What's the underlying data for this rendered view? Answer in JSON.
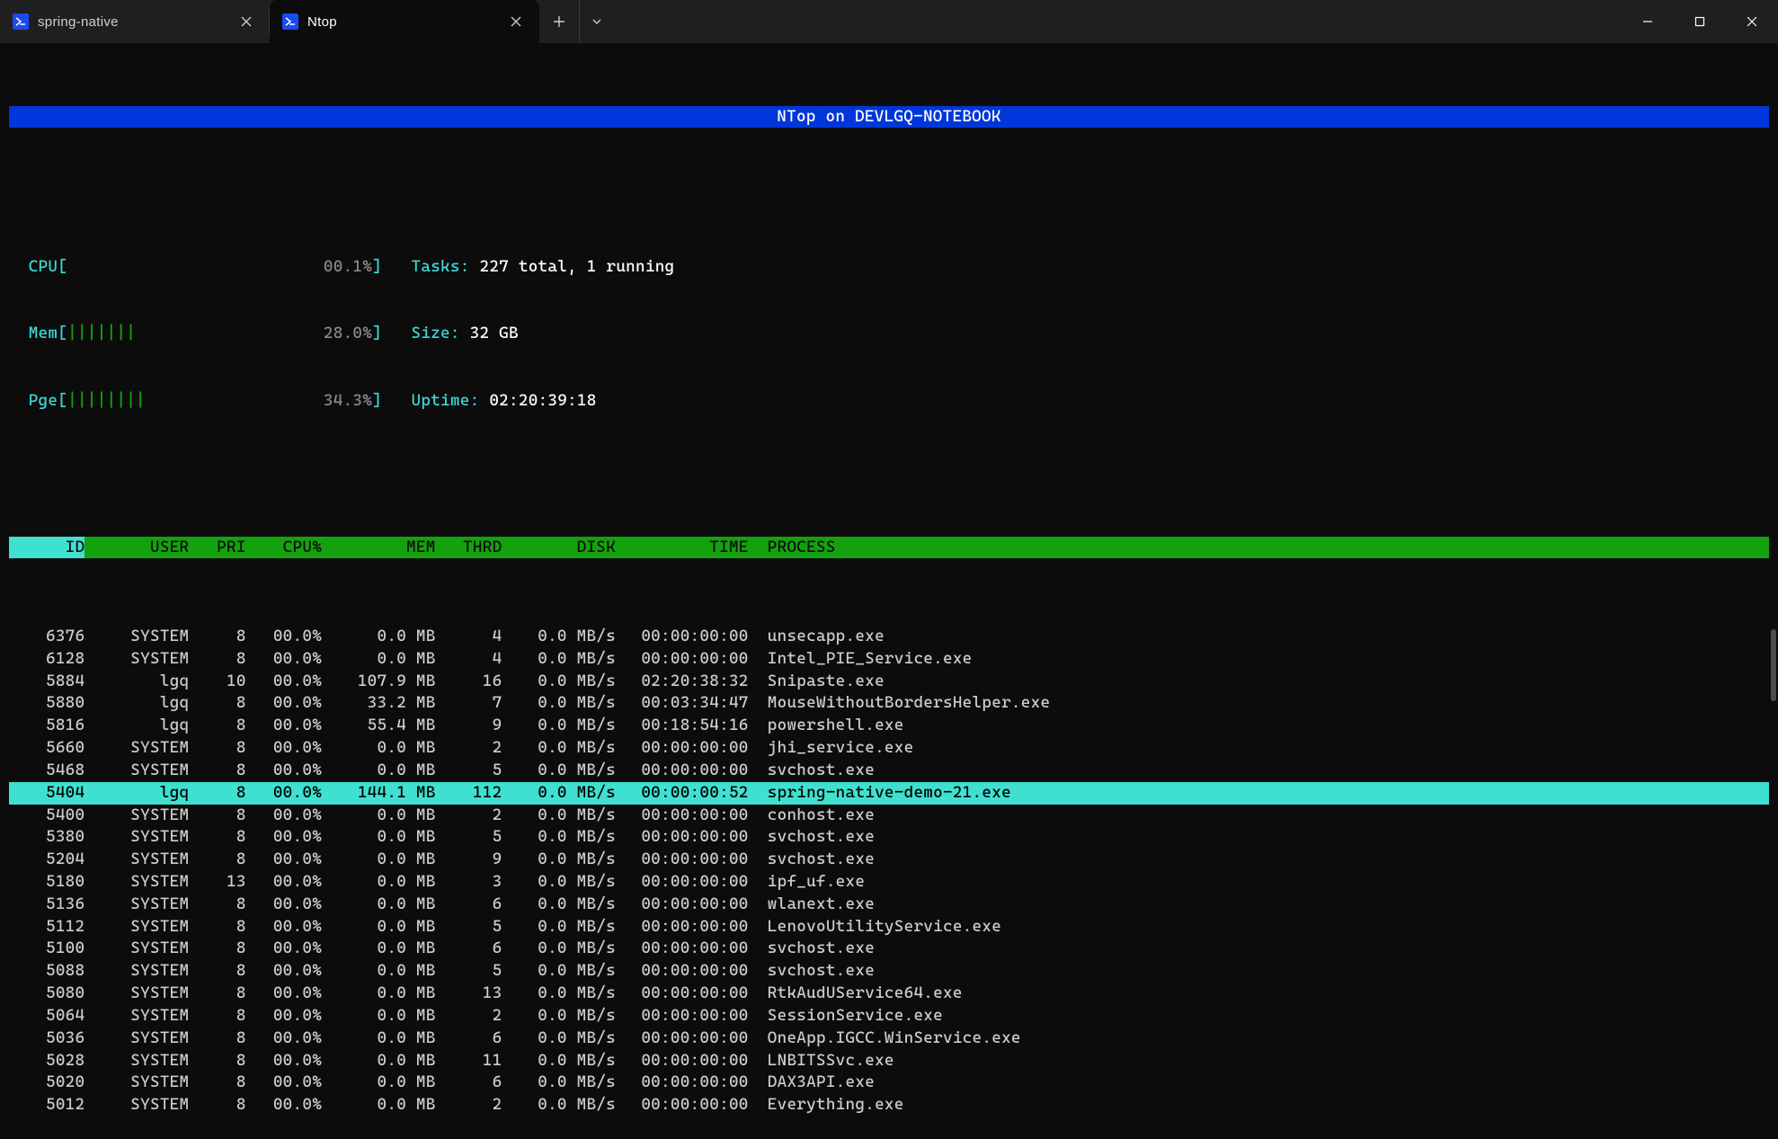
{
  "titlebar": {
    "tabs": [
      {
        "label": "spring-native",
        "icon": "powershell-icon",
        "active": false
      },
      {
        "label": "Ntop",
        "icon": "powershell-icon",
        "active": true
      }
    ],
    "newtab_tooltip": "New tab",
    "dropdown_tooltip": "New tab dropdown"
  },
  "banner": "NTop on DEVLGQ-NOTEBOOK",
  "meters": {
    "cpu": {
      "label": "CPU",
      "bars": "",
      "pct": "00.1%"
    },
    "mem": {
      "label": "Mem",
      "bars": "|||||||",
      "pct": "28.0%"
    },
    "pge": {
      "label": "Pge",
      "bars": "||||||||",
      "pct": "34.3%"
    }
  },
  "summary": {
    "tasks_label": "Tasks:",
    "tasks_value": "227 total, 1 running",
    "size_label": "Size:",
    "size_value": "32 GB",
    "uptime_label": "Uptime:",
    "uptime_value": "02:20:39:18"
  },
  "columns": {
    "id": "ID",
    "user": "USER",
    "pri": "PRI",
    "cpu": "CPU%",
    "mem": "MEM",
    "thrd": "THRD",
    "disk": "DISK",
    "time": "TIME",
    "proc": "PROCESS"
  },
  "processes": [
    {
      "id": "6376",
      "user": "SYSTEM",
      "pri": "8",
      "cpu": "00.0%",
      "mem": "0.0 MB",
      "thrd": "4",
      "disk": "0.0 MB/s",
      "time": "00:00:00:00",
      "proc": "unsecapp.exe",
      "sel": false
    },
    {
      "id": "6128",
      "user": "SYSTEM",
      "pri": "8",
      "cpu": "00.0%",
      "mem": "0.0 MB",
      "thrd": "4",
      "disk": "0.0 MB/s",
      "time": "00:00:00:00",
      "proc": "Intel_PIE_Service.exe",
      "sel": false
    },
    {
      "id": "5884",
      "user": "lgq",
      "pri": "10",
      "cpu": "00.0%",
      "mem": "107.9 MB",
      "thrd": "16",
      "disk": "0.0 MB/s",
      "time": "02:20:38:32",
      "proc": "Snipaste.exe",
      "sel": false
    },
    {
      "id": "5880",
      "user": "lgq",
      "pri": "8",
      "cpu": "00.0%",
      "mem": "33.2 MB",
      "thrd": "7",
      "disk": "0.0 MB/s",
      "time": "00:03:34:47",
      "proc": "MouseWithoutBordersHelper.exe",
      "sel": false
    },
    {
      "id": "5816",
      "user": "lgq",
      "pri": "8",
      "cpu": "00.0%",
      "mem": "55.4 MB",
      "thrd": "9",
      "disk": "0.0 MB/s",
      "time": "00:18:54:16",
      "proc": "powershell.exe",
      "sel": false
    },
    {
      "id": "5660",
      "user": "SYSTEM",
      "pri": "8",
      "cpu": "00.0%",
      "mem": "0.0 MB",
      "thrd": "2",
      "disk": "0.0 MB/s",
      "time": "00:00:00:00",
      "proc": "jhi_service.exe",
      "sel": false
    },
    {
      "id": "5468",
      "user": "SYSTEM",
      "pri": "8",
      "cpu": "00.0%",
      "mem": "0.0 MB",
      "thrd": "5",
      "disk": "0.0 MB/s",
      "time": "00:00:00:00",
      "proc": "svchost.exe",
      "sel": false
    },
    {
      "id": "5404",
      "user": "lgq",
      "pri": "8",
      "cpu": "00.0%",
      "mem": "144.1 MB",
      "thrd": "112",
      "disk": "0.0 MB/s",
      "time": "00:00:00:52",
      "proc": "spring-native-demo-21.exe",
      "sel": true
    },
    {
      "id": "5400",
      "user": "SYSTEM",
      "pri": "8",
      "cpu": "00.0%",
      "mem": "0.0 MB",
      "thrd": "2",
      "disk": "0.0 MB/s",
      "time": "00:00:00:00",
      "proc": "conhost.exe",
      "sel": false
    },
    {
      "id": "5380",
      "user": "SYSTEM",
      "pri": "8",
      "cpu": "00.0%",
      "mem": "0.0 MB",
      "thrd": "5",
      "disk": "0.0 MB/s",
      "time": "00:00:00:00",
      "proc": "svchost.exe",
      "sel": false
    },
    {
      "id": "5204",
      "user": "SYSTEM",
      "pri": "8",
      "cpu": "00.0%",
      "mem": "0.0 MB",
      "thrd": "9",
      "disk": "0.0 MB/s",
      "time": "00:00:00:00",
      "proc": "svchost.exe",
      "sel": false
    },
    {
      "id": "5180",
      "user": "SYSTEM",
      "pri": "13",
      "cpu": "00.0%",
      "mem": "0.0 MB",
      "thrd": "3",
      "disk": "0.0 MB/s",
      "time": "00:00:00:00",
      "proc": "ipf_uf.exe",
      "sel": false
    },
    {
      "id": "5136",
      "user": "SYSTEM",
      "pri": "8",
      "cpu": "00.0%",
      "mem": "0.0 MB",
      "thrd": "6",
      "disk": "0.0 MB/s",
      "time": "00:00:00:00",
      "proc": "wlanext.exe",
      "sel": false
    },
    {
      "id": "5112",
      "user": "SYSTEM",
      "pri": "8",
      "cpu": "00.0%",
      "mem": "0.0 MB",
      "thrd": "5",
      "disk": "0.0 MB/s",
      "time": "00:00:00:00",
      "proc": "LenovoUtilityService.exe",
      "sel": false
    },
    {
      "id": "5100",
      "user": "SYSTEM",
      "pri": "8",
      "cpu": "00.0%",
      "mem": "0.0 MB",
      "thrd": "6",
      "disk": "0.0 MB/s",
      "time": "00:00:00:00",
      "proc": "svchost.exe",
      "sel": false
    },
    {
      "id": "5088",
      "user": "SYSTEM",
      "pri": "8",
      "cpu": "00.0%",
      "mem": "0.0 MB",
      "thrd": "5",
      "disk": "0.0 MB/s",
      "time": "00:00:00:00",
      "proc": "svchost.exe",
      "sel": false
    },
    {
      "id": "5080",
      "user": "SYSTEM",
      "pri": "8",
      "cpu": "00.0%",
      "mem": "0.0 MB",
      "thrd": "13",
      "disk": "0.0 MB/s",
      "time": "00:00:00:00",
      "proc": "RtkAudUService64.exe",
      "sel": false
    },
    {
      "id": "5064",
      "user": "SYSTEM",
      "pri": "8",
      "cpu": "00.0%",
      "mem": "0.0 MB",
      "thrd": "2",
      "disk": "0.0 MB/s",
      "time": "00:00:00:00",
      "proc": "SessionService.exe",
      "sel": false
    },
    {
      "id": "5036",
      "user": "SYSTEM",
      "pri": "8",
      "cpu": "00.0%",
      "mem": "0.0 MB",
      "thrd": "6",
      "disk": "0.0 MB/s",
      "time": "00:00:00:00",
      "proc": "OneApp.IGCC.WinService.exe",
      "sel": false
    },
    {
      "id": "5028",
      "user": "SYSTEM",
      "pri": "8",
      "cpu": "00.0%",
      "mem": "0.0 MB",
      "thrd": "11",
      "disk": "0.0 MB/s",
      "time": "00:00:00:00",
      "proc": "LNBITSSvc.exe",
      "sel": false
    },
    {
      "id": "5020",
      "user": "SYSTEM",
      "pri": "8",
      "cpu": "00.0%",
      "mem": "0.0 MB",
      "thrd": "6",
      "disk": "0.0 MB/s",
      "time": "00:00:00:00",
      "proc": "DAX3API.exe",
      "sel": false
    },
    {
      "id": "5012",
      "user": "SYSTEM",
      "pri": "8",
      "cpu": "00.0%",
      "mem": "0.0 MB",
      "thrd": "2",
      "disk": "0.0 MB/s",
      "time": "00:00:00:00",
      "proc": "Everything.exe",
      "sel": false
    }
  ]
}
